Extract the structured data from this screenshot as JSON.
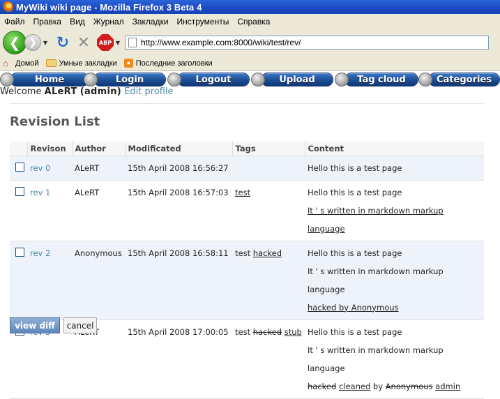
{
  "browser": {
    "window_title": "MyWiki wiki page - Mozilla Firefox 3 Beta 4",
    "menu": [
      "Файл",
      "Правка",
      "Вид",
      "Журнал",
      "Закладки",
      "Инструменты",
      "Справка"
    ],
    "url": "http://www.example.com:8000/wiki/test/rev/",
    "bookmarks": [
      "Домой",
      "Умные закладки",
      "Последние заголовки"
    ],
    "abp_label": "ABP"
  },
  "site_nav": {
    "items": [
      "Home",
      "Login",
      "Logout",
      "Upload",
      "Tag cloud",
      "Categories"
    ]
  },
  "welcome": {
    "prefix": "Welcome",
    "username": "ALeRT",
    "role": "(admin)",
    "edit_profile": "Edit profile"
  },
  "page": {
    "title": "Revision List"
  },
  "table": {
    "headers": {
      "revision": "Revison",
      "author": "Author",
      "modified": "Modificated",
      "tags": "Tags",
      "content": "Content"
    },
    "rows": [
      {
        "rev": "rev 0",
        "author": "ALeRT",
        "date": "15th April 2008 16:56:27",
        "tags": [],
        "content_lines": [
          "Hello this is a test page"
        ]
      },
      {
        "rev": "rev 1",
        "author": "ALeRT",
        "date": "15th April 2008 16:57:03",
        "tags": [
          "test"
        ],
        "content_lines": [
          "Hello this is a test page",
          "It ' s written in markdown markup language"
        ]
      },
      {
        "rev": "rev 2",
        "author": "Anonymous",
        "date": "15th April 2008 16:58:11",
        "tags": [
          "test",
          "hacked"
        ],
        "content_lines": [
          "Hello this is a test page",
          "It ' s written in markdown markup language",
          "hacked by Anonymous"
        ]
      },
      {
        "rev": "rev 3",
        "author": "ALeRT",
        "date": "15th April 2008 17:00:05",
        "tags": [
          "test",
          "hacked",
          "stub"
        ],
        "content_lines": [
          "Hello this is a test page",
          "It ' s written in markdown markup language"
        ],
        "content_diff": {
          "removed_1": "hacked",
          "added_1": "cleaned",
          "by": "by",
          "removed_2": "Anonymous",
          "added_2": "admin"
        }
      }
    ]
  },
  "actions": {
    "view_diff": "view diff",
    "cancel": "cancel"
  },
  "colors": {
    "link": "#4a8aa8",
    "nav_pill": "#1c4e94",
    "row_highlight": "#eef3fb",
    "button_primary": "#6f95c4"
  }
}
